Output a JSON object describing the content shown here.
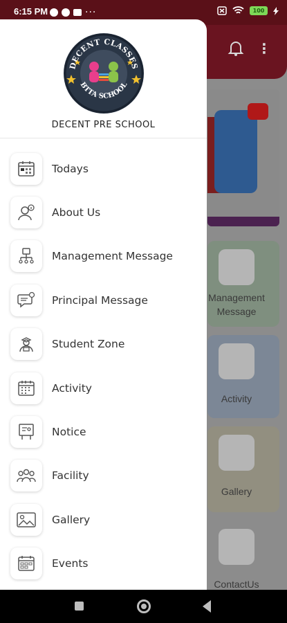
{
  "status_bar": {
    "time": "6:15 PM",
    "more": "···",
    "battery": "100"
  },
  "drawer": {
    "logo_top_text": "DECENT CLASSES",
    "logo_bottom_text": "BTTA SCHOOL",
    "school_name": "DECENT PRE SCHOOL",
    "items": [
      {
        "label": "Todays",
        "icon": "calendar-icon"
      },
      {
        "label": "About Us",
        "icon": "person-info-icon"
      },
      {
        "label": "Management Message",
        "icon": "org-chart-icon"
      },
      {
        "label": "Principal Message",
        "icon": "chat-bubble-icon"
      },
      {
        "label": "Student Zone",
        "icon": "student-icon"
      },
      {
        "label": "Activity",
        "icon": "activity-calendar-icon"
      },
      {
        "label": "Notice",
        "icon": "notice-board-icon"
      },
      {
        "label": "Facility",
        "icon": "group-icon"
      },
      {
        "label": "Gallery",
        "icon": "gallery-icon"
      },
      {
        "label": "Events",
        "icon": "events-calendar-icon"
      }
    ]
  },
  "background": {
    "cards": [
      {
        "label": "Management\nMessage"
      },
      {
        "label": "Activity"
      },
      {
        "label": "Gallery"
      },
      {
        "label": "ContactUs"
      }
    ]
  },
  "colors": {
    "header": "#6a1420",
    "status_bar": "#5a1018",
    "drawer_bg": "#ffffff",
    "battery": "#7ed957"
  }
}
